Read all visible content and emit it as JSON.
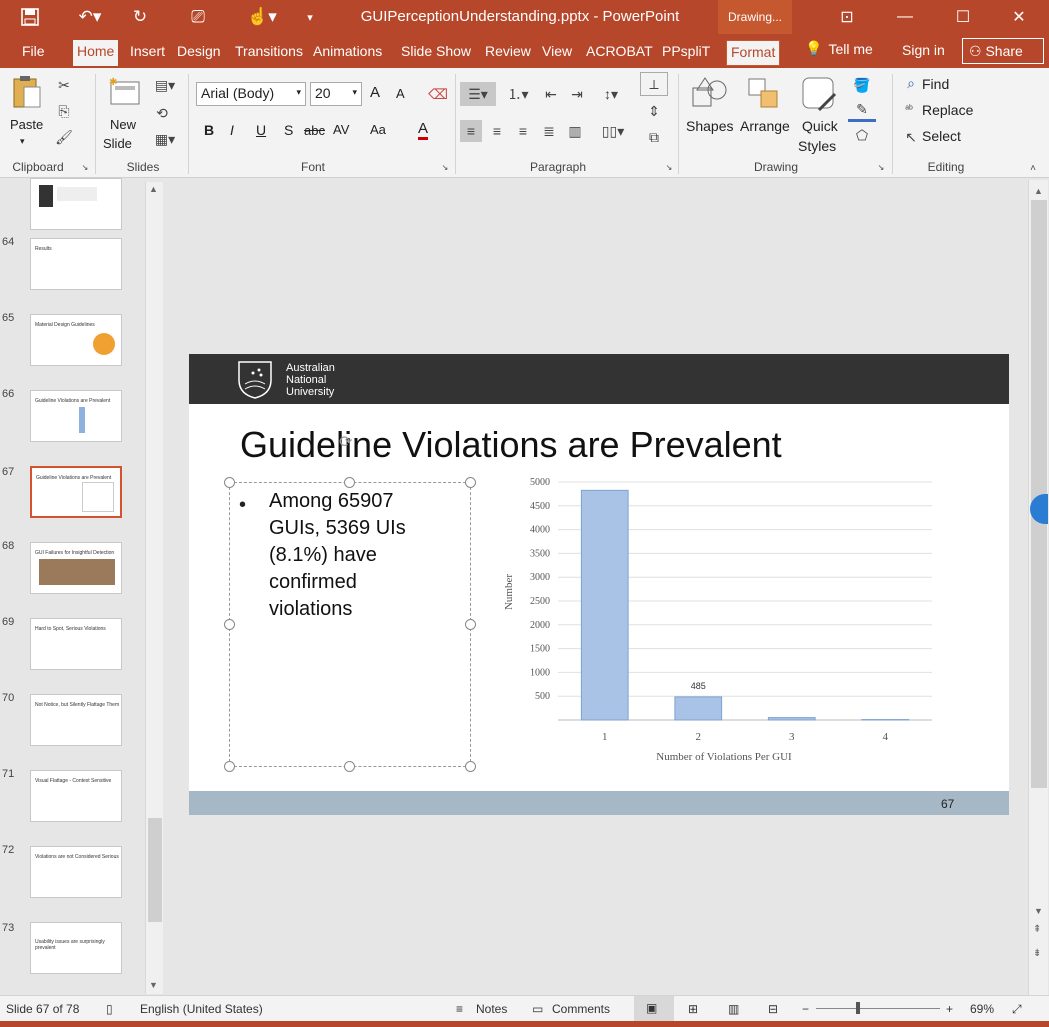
{
  "titlebar": {
    "document_title": "GUIPerceptionUnderstanding.pptx - PowerPoint",
    "contextual_tab_header": "Drawing...",
    "save_icon": "save-icon",
    "undo_icon": "undo-icon",
    "redo_icon": "redo-icon",
    "present_icon": "present-icon",
    "touch_icon": "touch-icon",
    "restore_ribbon_icon": "ribbon-display-icon"
  },
  "tabs": [
    "File",
    "Home",
    "Insert",
    "Design",
    "Transitions",
    "Animations",
    "Slide Show",
    "Review",
    "View",
    "ACROBAT",
    "PPspliT",
    "Format"
  ],
  "tell_me": "Tell me",
  "sign_in": "Sign in",
  "share": "Share",
  "ribbon": {
    "clipboard": {
      "paste": "Paste",
      "label": "Clipboard"
    },
    "slides": {
      "new_slide_line1": "New",
      "new_slide_line2": "Slide",
      "label": "Slides"
    },
    "font": {
      "font_name": "Arial (Body)",
      "font_size": "20",
      "bold": "B",
      "italic": "I",
      "underline": "U",
      "shadow": "S",
      "strike": "abc",
      "spacing": "AV",
      "case": "Aa",
      "color": "A",
      "grow": "A",
      "shrink": "A",
      "label": "Font"
    },
    "paragraph": {
      "label": "Paragraph"
    },
    "drawing": {
      "shapes": "Shapes",
      "arrange": "Arrange",
      "quick_line1": "Quick",
      "quick_line2": "Styles",
      "label": "Drawing"
    },
    "editing": {
      "find": "Find",
      "replace": "Replace",
      "select": "Select",
      "label": "Editing"
    }
  },
  "thumbnails": [
    {
      "num": "",
      "title": ""
    },
    {
      "num": "64",
      "title": "Results"
    },
    {
      "num": "65",
      "title": "Material Design Guidelines"
    },
    {
      "num": "66",
      "title": "Guideline Violations are Prevalent"
    },
    {
      "num": "67",
      "title": "Guideline Violations are Prevalent"
    },
    {
      "num": "68",
      "title": "GUI Failures for Insightful Detection"
    },
    {
      "num": "69",
      "title": "Hard to Spot, Serious Violations"
    },
    {
      "num": "70",
      "title": "Not Notice, but Silently Flattage Them"
    },
    {
      "num": "71",
      "title": "Visual Flattage - Context Sensitive"
    },
    {
      "num": "72",
      "title": "Violations are not Considered Serious"
    },
    {
      "num": "73",
      "title": "Usability issues are surprisingly prevalent"
    }
  ],
  "slide": {
    "logo_text": "Australian National University",
    "title": "Guideline Violations are Prevalent",
    "bullet": "Among 65907 GUIs, 5369 UIs (8.1%) have confirmed violations",
    "page_number": "67"
  },
  "chart_data": {
    "type": "bar",
    "categories": [
      "1",
      "2",
      "3",
      "4"
    ],
    "values": [
      4825,
      485,
      50,
      9
    ],
    "data_labels": [
      "",
      "485",
      "",
      ""
    ],
    "xlabel": "Number of Violations Per GUI",
    "ylabel": "Number",
    "yticks": [
      "500",
      "1000",
      "1500",
      "2000",
      "2500",
      "3000",
      "3500",
      "4000",
      "4500",
      "5000"
    ],
    "ylim": [
      0,
      5000
    ],
    "grid": true,
    "colors": {
      "bar": "#a8c3e6",
      "bar_border": "#7fa2d0"
    }
  },
  "statusbar": {
    "slide_info": "Slide 67 of 78",
    "language": "English (United States)",
    "notes": "Notes",
    "comments": "Comments",
    "zoom": "69%"
  },
  "colors": {
    "accent": "#b7472a",
    "ribbon_bg": "#f3f3f3",
    "slide_header": "#333333",
    "slide_footer": "#a6b7c6"
  }
}
